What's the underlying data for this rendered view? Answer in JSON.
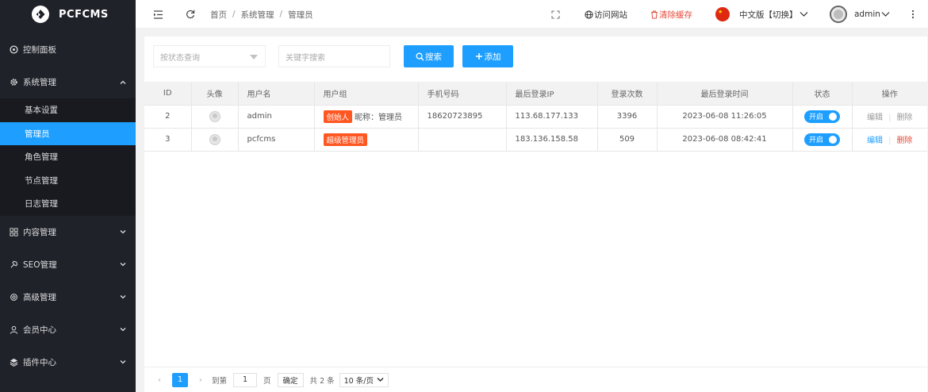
{
  "brand": {
    "name": "PCFCMS"
  },
  "sidebar": {
    "items": [
      {
        "label": "控制面板",
        "icon": "dashboard-icon"
      },
      {
        "label": "系统管理",
        "icon": "gear-icon",
        "expanded": true,
        "children": [
          "基本设置",
          "管理员",
          "角色管理",
          "节点管理",
          "日志管理"
        ],
        "active_child": "管理员"
      },
      {
        "label": "内容管理",
        "icon": "grid-icon"
      },
      {
        "label": "SEO管理",
        "icon": "tool-icon"
      },
      {
        "label": "高级管理",
        "icon": "advanced-gear-icon"
      },
      {
        "label": "会员中心",
        "icon": "user-icon"
      },
      {
        "label": "插件中心",
        "icon": "layers-icon"
      }
    ]
  },
  "header": {
    "breadcrumb": [
      "首页",
      "系统管理",
      "管理员"
    ],
    "visit_site": "访问网站",
    "clear_cache": "清除缓存",
    "language": "中文版【切换】",
    "user": "admin"
  },
  "filters": {
    "status_placeholder": "按状态查询",
    "keyword_placeholder": "关键字搜索",
    "search_label": "搜索",
    "add_label": "添加"
  },
  "table": {
    "columns": [
      "ID",
      "头像",
      "用户名",
      "用户组",
      "手机号码",
      "最后登录IP",
      "登录次数",
      "最后登录时间",
      "状态",
      "操作"
    ],
    "rows": [
      {
        "id": "2",
        "username": "admin",
        "group_tag": "创始人",
        "group_note": "昵称：管理员",
        "phone": "18620723895",
        "ip": "113.68.177.133",
        "logins": "3396",
        "last_login": "2023-06-08 11:26:05",
        "status": "开启",
        "edit": "编辑",
        "delete": "删除",
        "actions_enabled": false
      },
      {
        "id": "3",
        "username": "pcfcms",
        "group_tag": "超级管理员",
        "group_note": "",
        "phone": "",
        "ip": "183.136.158.58",
        "logins": "509",
        "last_login": "2023-06-08 08:42:41",
        "status": "开启",
        "edit": "编辑",
        "delete": "删除",
        "actions_enabled": true
      }
    ]
  },
  "pager": {
    "prev": "‹",
    "next": "›",
    "current": "1",
    "goto_label": "到第",
    "goto_value": "1",
    "page_unit": "页",
    "confirm": "确定",
    "total": "共 2 条",
    "page_size": "10 条/页"
  },
  "colors": {
    "accent": "#1e9fff",
    "sidebar": "#20222a",
    "tag": "#ff5722",
    "danger": "#e64c3c"
  }
}
